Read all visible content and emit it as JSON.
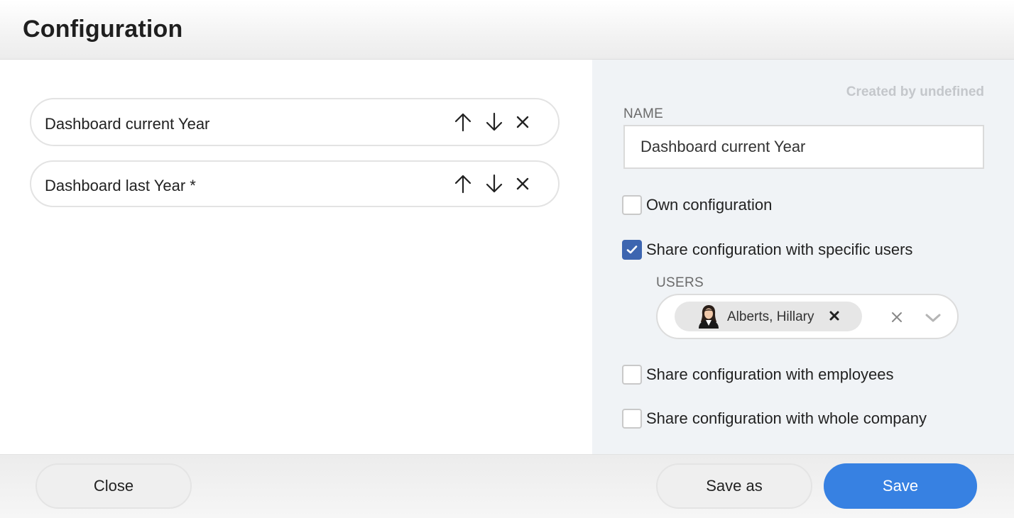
{
  "header": {
    "title": "Configuration"
  },
  "configs": {
    "items": [
      {
        "label": "Dashboard current Year"
      },
      {
        "label": "Dashboard last Year *"
      }
    ],
    "icons": {
      "up": "arrow-up-icon",
      "down": "arrow-down-icon",
      "remove": "close-icon"
    }
  },
  "details": {
    "created_by": "Created by undefined",
    "name_label": "NAME",
    "name_value": "Dashboard current Year",
    "own_config": {
      "label": "Own configuration",
      "checked": false
    },
    "share_users": {
      "label": "Share configuration with specific users",
      "checked": true
    },
    "users_label": "USERS",
    "users": [
      {
        "name": "Alberts, Hillary"
      }
    ],
    "share_employees": {
      "label": "Share configuration with employees",
      "checked": false
    },
    "share_company": {
      "label": "Share configuration with whole company",
      "checked": false
    }
  },
  "footer": {
    "close_label": "Close",
    "save_as_label": "Save as",
    "save_label": "Save"
  },
  "colors": {
    "primary": "#3781e2",
    "checkbox_checked": "#3d65b0",
    "panel_bg": "#f0f3f6"
  }
}
